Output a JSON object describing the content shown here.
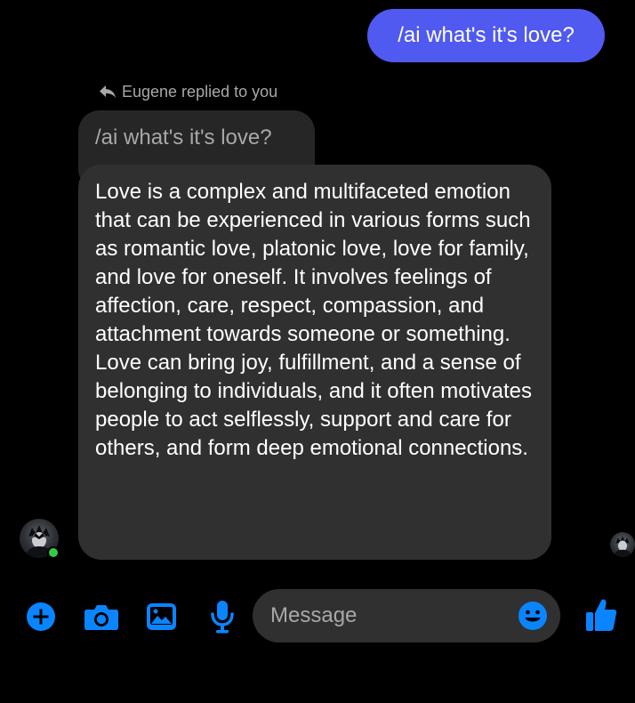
{
  "conversation": {
    "sent_message": "/ai what's it's love?",
    "reply_indicator": "Eugene replied to you",
    "quoted_message": "/ai what's it's love?",
    "reply_message": "Love is a complex and multifaceted emotion that can be experienced in various forms such as romantic love, platonic love, love for family, and love for oneself. It involves feelings of affection, care, respect, compassion, and attachment towards someone or something. Love can bring joy, fulfillment, and a sense of belonging to individuals, and it often motivates people to act selflessly, support and care for others, and form deep emotional connections.",
    "sender_online": true
  },
  "composer": {
    "placeholder": "Message",
    "value": "",
    "icons": [
      "plus-icon",
      "camera-icon",
      "image-icon",
      "microphone-icon",
      "emoji-icon",
      "thumbs-up-icon"
    ]
  },
  "colors": {
    "background": "#000000",
    "sent_bubble": "#5059f0",
    "received_bubble": "#303030",
    "quoted_bubble": "#262626",
    "accent": "#0a84ff",
    "online": "#31cc46",
    "muted_text": "#a8a8a8"
  }
}
